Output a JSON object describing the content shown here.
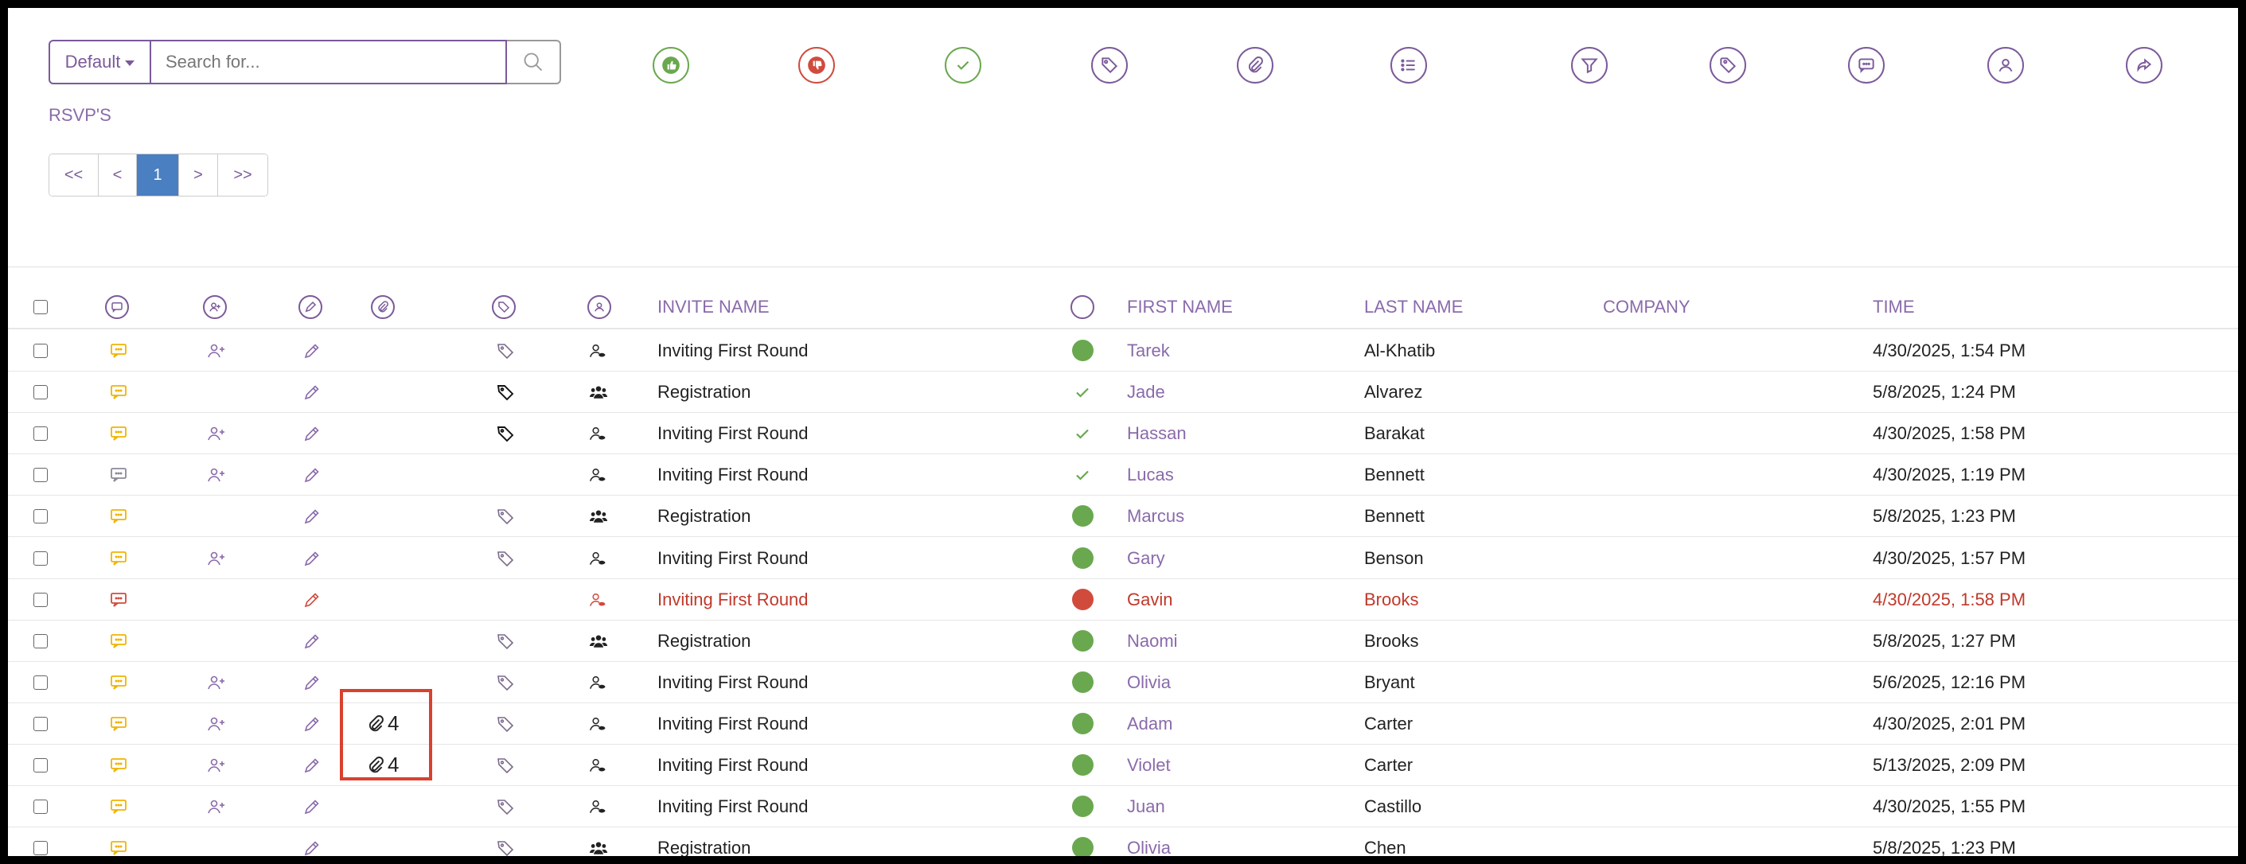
{
  "search": {
    "dropdown_label": "Default",
    "placeholder": "Search for...",
    "value": ""
  },
  "toolbar_icons": [
    "thumbs-up-icon",
    "thumbs-down-icon",
    "check-icon",
    "tag-icon",
    "paperclip-icon",
    "list-icon",
    "filter-icon",
    "tags-icon",
    "comment-icon",
    "user-icon",
    "share-icon"
  ],
  "rsvp_link": "RSVP'S",
  "pagination": {
    "first": "<<",
    "prev": "<",
    "current": "1",
    "next": ">",
    "last": ">>"
  },
  "table": {
    "columns": {
      "invite_name": "INVITE NAME",
      "first_name": "FIRST NAME",
      "last_name": "LAST NAME",
      "company": "COMPANY",
      "time": "TIME"
    },
    "rows": [
      {
        "comment": "yellow",
        "add_user": true,
        "tag": "outline",
        "person": "single",
        "invite": "Inviting First Round",
        "status": "green",
        "first": "Tarek",
        "last": "Al-Khatib",
        "company": "",
        "time": "4/30/2025, 1:54 PM"
      },
      {
        "comment": "yellow",
        "add_user": false,
        "tag": "black",
        "person": "group",
        "invite": "Registration",
        "status": "check",
        "first": "Jade",
        "last": "Alvarez",
        "company": "",
        "time": "5/8/2025, 1:24 PM"
      },
      {
        "comment": "yellow",
        "add_user": true,
        "tag": "black",
        "person": "single",
        "invite": "Inviting First Round",
        "status": "check",
        "first": "Hassan",
        "last": "Barakat",
        "company": "",
        "time": "4/30/2025, 1:58 PM"
      },
      {
        "comment": "gray",
        "add_user": true,
        "tag": "none",
        "person": "single",
        "invite": "Inviting First Round",
        "status": "check",
        "first": "Lucas",
        "last": "Bennett",
        "company": "",
        "time": "4/30/2025, 1:19 PM"
      },
      {
        "comment": "yellow",
        "add_user": false,
        "tag": "outline",
        "person": "group",
        "invite": "Registration",
        "status": "green",
        "first": "Marcus",
        "last": "Bennett",
        "company": "",
        "time": "5/8/2025, 1:23 PM"
      },
      {
        "comment": "yellow",
        "add_user": true,
        "tag": "outline",
        "person": "single",
        "invite": "Inviting First Round",
        "status": "green",
        "first": "Gary",
        "last": "Benson",
        "company": "",
        "time": "4/30/2025, 1:57 PM"
      },
      {
        "comment": "red",
        "add_user": false,
        "tag": "none",
        "person": "single-red",
        "invite": "Inviting First Round",
        "status": "red",
        "first": "Gavin",
        "last": "Brooks",
        "company": "",
        "time": "4/30/2025, 1:58 PM",
        "flag": true
      },
      {
        "comment": "yellow",
        "add_user": false,
        "tag": "outline",
        "person": "group",
        "invite": "Registration",
        "status": "green",
        "first": "Naomi",
        "last": "Brooks",
        "company": "",
        "time": "5/8/2025, 1:27 PM"
      },
      {
        "comment": "yellow",
        "add_user": true,
        "tag": "outline",
        "person": "single",
        "invite": "Inviting First Round",
        "status": "green",
        "first": "Olivia",
        "last": "Bryant",
        "company": "",
        "time": "5/6/2025, 12:16 PM"
      },
      {
        "comment": "yellow",
        "add_user": true,
        "tag": "outline",
        "person": "single",
        "invite": "Inviting First Round",
        "status": "green",
        "first": "Adam",
        "last": "Carter",
        "company": "",
        "time": "4/30/2025, 2:01 PM",
        "attachments": "4"
      },
      {
        "comment": "yellow",
        "add_user": true,
        "tag": "outline",
        "person": "single",
        "invite": "Inviting First Round",
        "status": "green",
        "first": "Violet",
        "last": "Carter",
        "company": "",
        "time": "5/13/2025, 2:09 PM",
        "attachments": "4"
      },
      {
        "comment": "yellow",
        "add_user": true,
        "tag": "outline",
        "person": "single",
        "invite": "Inviting First Round",
        "status": "green",
        "first": "Juan",
        "last": "Castillo",
        "company": "",
        "time": "4/30/2025, 1:55 PM"
      },
      {
        "comment": "yellow",
        "add_user": false,
        "tag": "outline",
        "person": "group",
        "invite": "Registration",
        "status": "green",
        "first": "Olivia",
        "last": "Chen",
        "company": "",
        "time": "5/8/2025, 1:23 PM"
      }
    ]
  },
  "colors": {
    "accent": "#7b5a9a",
    "green": "#6aa84f",
    "red": "#d14b3d",
    "yellow": "#f0b400",
    "pager_active": "#4a7fc1"
  }
}
